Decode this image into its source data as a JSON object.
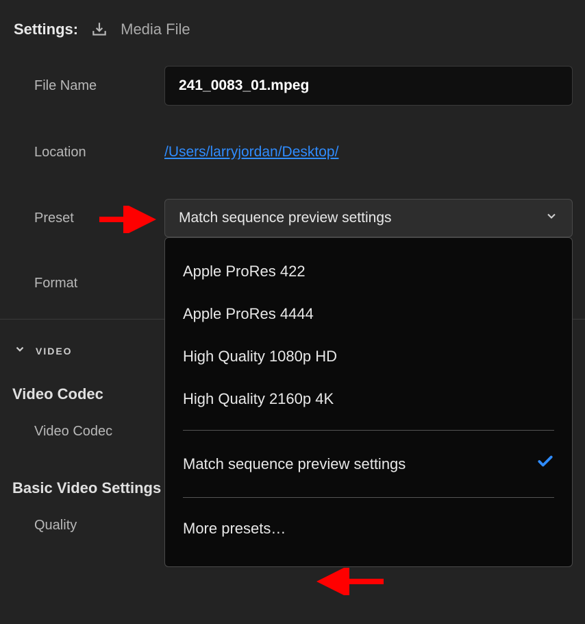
{
  "header": {
    "title": "Settings:",
    "media_label": "Media File"
  },
  "form": {
    "file_name_label": "File Name",
    "file_name_value": "241_0083_01.mpeg",
    "location_label": "Location",
    "location_value": "/Users/larryjordan/Desktop/",
    "preset_label": "Preset",
    "preset_value": "Match sequence preview settings",
    "format_label": "Format"
  },
  "sections": {
    "video_heading": "VIDEO",
    "video_codec_heading": "Video Codec",
    "video_codec_label": "Video Codec",
    "basic_video_heading": "Basic Video Settings",
    "quality_label": "Quality"
  },
  "preset_menu": {
    "items": [
      "Apple ProRes 422",
      "Apple ProRes 4444",
      "High Quality 1080p HD",
      "High Quality 2160p 4K"
    ],
    "selected": "Match sequence preview settings",
    "more": "More presets…"
  }
}
